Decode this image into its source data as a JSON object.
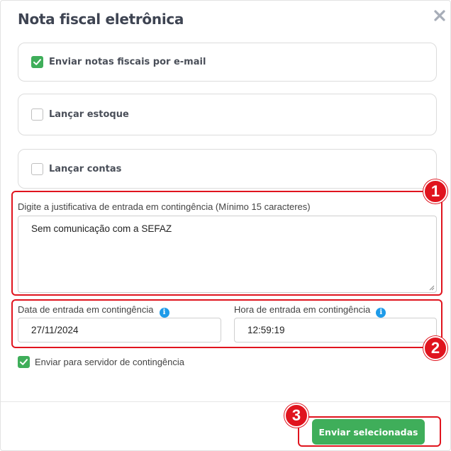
{
  "modal": {
    "title": "Nota fiscal eletrônica",
    "close_icon": "close-icon"
  },
  "options": [
    {
      "label": "Enviar notas fiscais por e-mail",
      "checked": true
    },
    {
      "label": "Lançar estoque",
      "checked": false
    },
    {
      "label": "Lançar contas",
      "checked": false
    }
  ],
  "justification": {
    "label": "Digite a justificativa de entrada em contingência (Mínimo 15 caracteres)",
    "value": "Sem comunicação com a SEFAZ"
  },
  "date": {
    "label": "Data de entrada em contingência",
    "value": "27/11/2024",
    "info_icon": "info-icon"
  },
  "time": {
    "label": "Hora de entrada em contingência",
    "value": "12:59:19",
    "info_icon": "info-icon"
  },
  "contingency_server": {
    "label": "Enviar para servidor de contingência",
    "checked": true
  },
  "footer": {
    "send_label": "Enviar selecionadas"
  },
  "annotations": [
    "1",
    "2",
    "3"
  ],
  "colors": {
    "accent_green": "#3fae5a",
    "highlight_red": "#e0141e",
    "info_blue": "#1e9be9"
  }
}
